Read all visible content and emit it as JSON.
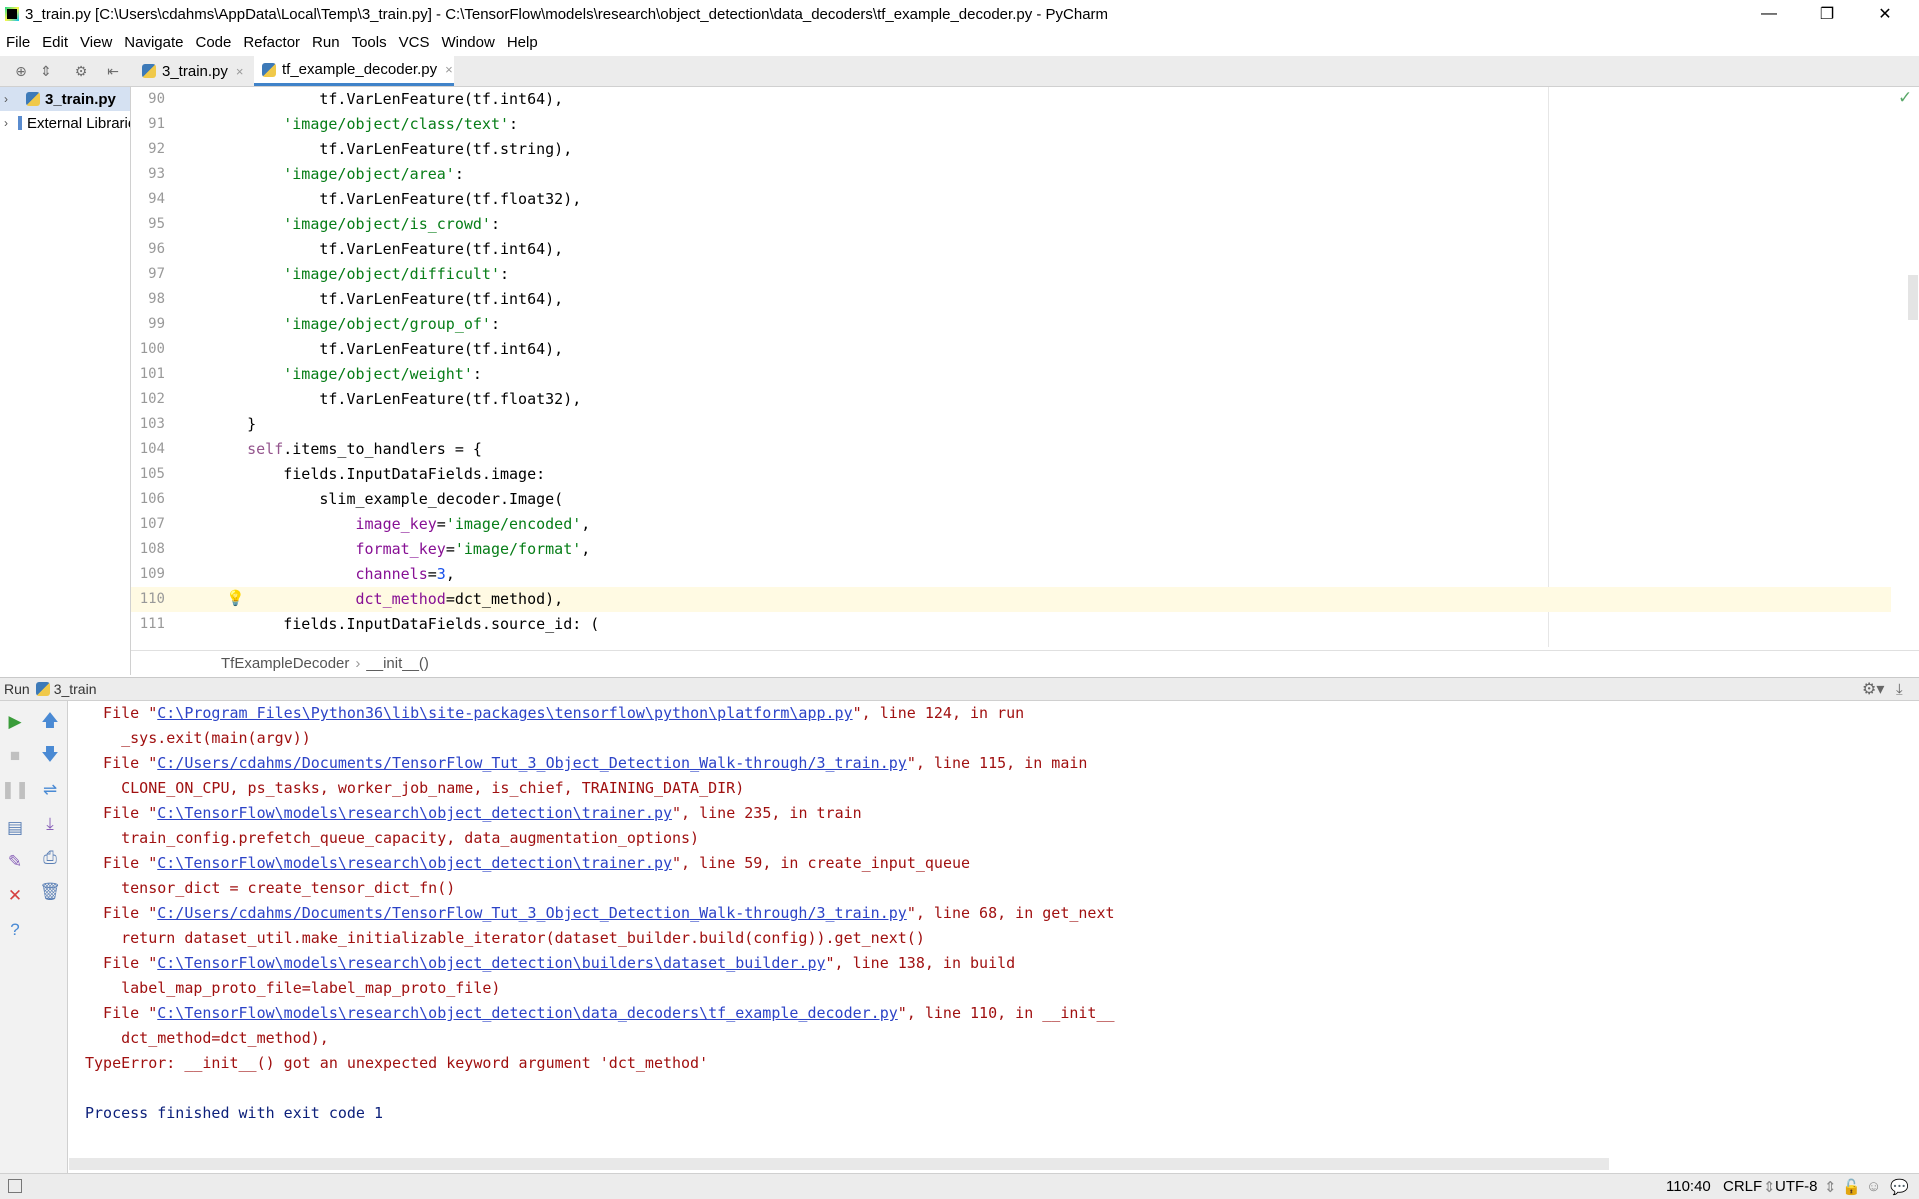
{
  "window": {
    "title": "3_train.py [C:\\Users\\cdahms\\AppData\\Local\\Temp\\3_train.py] - C:\\TensorFlow\\models\\research\\object_detection\\data_decoders\\tf_example_decoder.py - PyCharm",
    "minimize": "—",
    "restore": "❐",
    "close": "✕"
  },
  "menu": [
    "File",
    "Edit",
    "View",
    "Navigate",
    "Code",
    "Refactor",
    "Run",
    "Tools",
    "VCS",
    "Window",
    "Help"
  ],
  "tabs": [
    {
      "label": "3_train.py",
      "close": "×"
    },
    {
      "label": "tf_example_decoder.py",
      "close": "×"
    }
  ],
  "project": {
    "items": [
      {
        "label": "3_train.py",
        "arrow": "›"
      },
      {
        "label": "External Libraries",
        "arrow": "›"
      }
    ]
  },
  "editor": {
    "lines": [
      {
        "num": "90",
        "text": "            tf.VarLenFeature(tf.int64),"
      },
      {
        "num": "91",
        "text": "        'image/object/class/text':"
      },
      {
        "num": "92",
        "text": "            tf.VarLenFeature(tf.string),"
      },
      {
        "num": "93",
        "text": "        'image/object/area':"
      },
      {
        "num": "94",
        "text": "            tf.VarLenFeature(tf.float32),"
      },
      {
        "num": "95",
        "text": "        'image/object/is_crowd':"
      },
      {
        "num": "96",
        "text": "            tf.VarLenFeature(tf.int64),"
      },
      {
        "num": "97",
        "text": "        'image/object/difficult':"
      },
      {
        "num": "98",
        "text": "            tf.VarLenFeature(tf.int64),"
      },
      {
        "num": "99",
        "text": "        'image/object/group_of':"
      },
      {
        "num": "100",
        "text": "            tf.VarLenFeature(tf.int64),"
      },
      {
        "num": "101",
        "text": "        'image/object/weight':"
      },
      {
        "num": "102",
        "text": "            tf.VarLenFeature(tf.float32),"
      },
      {
        "num": "103",
        "text": "    }"
      },
      {
        "num": "104",
        "text": "    self.items_to_handlers = {"
      },
      {
        "num": "105",
        "text": "        fields.InputDataFields.image:"
      },
      {
        "num": "106",
        "text": "            slim_example_decoder.Image("
      },
      {
        "num": "107",
        "text": "                image_key='image/encoded',"
      },
      {
        "num": "108",
        "text": "                format_key='image/format',"
      },
      {
        "num": "109",
        "text": "                channels=3,"
      },
      {
        "num": "110",
        "text": "                dct_method=dct_method),"
      },
      {
        "num": "111",
        "text": "        fields.InputDataFields.source_id: ("
      }
    ],
    "current_line": "110"
  },
  "breadcrumb": [
    "TfExampleDecoder",
    "__init__()"
  ],
  "run": {
    "header_label": "Run",
    "config_name": "3_train",
    "console": [
      {
        "pre": "  File \"",
        "link": "C:\\Program Files\\Python36\\lib\\site-packages\\tensorflow\\python\\platform\\app.py",
        "post": "\", line 124, in run"
      },
      {
        "pre": "    _sys.exit(main(argv))",
        "link": "",
        "post": ""
      },
      {
        "pre": "  File \"",
        "link": "C:/Users/cdahms/Documents/TensorFlow_Tut_3_Object_Detection_Walk-through/3_train.py",
        "post": "\", line 115, in main"
      },
      {
        "pre": "    CLONE_ON_CPU, ps_tasks, worker_job_name, is_chief, TRAINING_DATA_DIR)",
        "link": "",
        "post": ""
      },
      {
        "pre": "  File \"",
        "link": "C:\\TensorFlow\\models\\research\\object_detection\\trainer.py",
        "post": "\", line 235, in train"
      },
      {
        "pre": "    train_config.prefetch_queue_capacity, data_augmentation_options)",
        "link": "",
        "post": ""
      },
      {
        "pre": "  File \"",
        "link": "C:\\TensorFlow\\models\\research\\object_detection\\trainer.py",
        "post": "\", line 59, in create_input_queue"
      },
      {
        "pre": "    tensor_dict = create_tensor_dict_fn()",
        "link": "",
        "post": ""
      },
      {
        "pre": "  File \"",
        "link": "C:/Users/cdahms/Documents/TensorFlow_Tut_3_Object_Detection_Walk-through/3_train.py",
        "post": "\", line 68, in get_next"
      },
      {
        "pre": "    return dataset_util.make_initializable_iterator(dataset_builder.build(config)).get_next()",
        "link": "",
        "post": ""
      },
      {
        "pre": "  File \"",
        "link": "C:\\TensorFlow\\models\\research\\object_detection\\builders\\dataset_builder.py",
        "post": "\", line 138, in build"
      },
      {
        "pre": "    label_map_proto_file=label_map_proto_file)",
        "link": "",
        "post": ""
      },
      {
        "pre": "  File \"",
        "link": "C:\\TensorFlow\\models\\research\\object_detection\\data_decoders\\tf_example_decoder.py",
        "post": "\", line 110, in __init__"
      },
      {
        "pre": "    dct_method=dct_method),",
        "link": "",
        "post": ""
      },
      {
        "pre": "TypeError: __init__() got an unexpected keyword argument 'dct_method'",
        "link": "",
        "post": ""
      },
      {
        "pre": "",
        "link": "",
        "post": ""
      },
      {
        "pre": "Process finished with exit code 1",
        "link": "",
        "post": ""
      }
    ]
  },
  "status": {
    "position": "110:40",
    "line_sep": "CRLF",
    "encoding": "UTF-8"
  },
  "colors": {
    "string": "#067d17",
    "keyword": "#871094",
    "number": "#1750eb",
    "error_text": "#a01010",
    "link": "#2c43c7",
    "current_line_bg": "#fffae3"
  }
}
